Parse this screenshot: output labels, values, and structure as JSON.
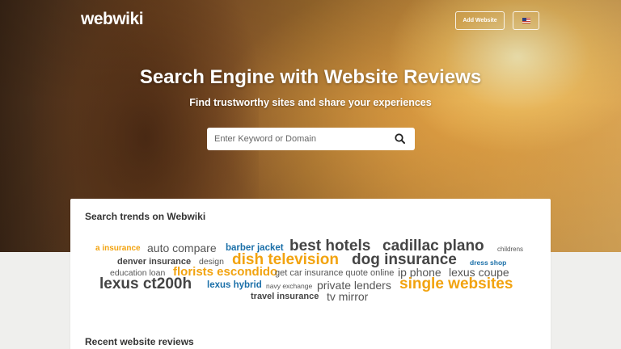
{
  "header": {
    "logo": "webwiki",
    "add_website_label": "Add Website",
    "language": "English (US)"
  },
  "hero": {
    "title": "Search Engine with Website Reviews",
    "subtitle": "Find trustworthy sites and share your experiences"
  },
  "search": {
    "placeholder": "Enter Keyword or Domain",
    "value": ""
  },
  "trends": {
    "title": "Search trends on Webwiki",
    "tags": {
      "a_insurance": "a insurance",
      "auto_compare": "auto compare",
      "barber_jacket": "barber jacket",
      "best_hotels": "best hotels",
      "cadillac_plano": "cadillac plano",
      "childrens": "childrens",
      "denver_insurance": "denver insurance",
      "design": "design",
      "dish_television": "dish television",
      "dog_insurance": "dog insurance",
      "dress_shop": "dress shop",
      "education_loan": "education loan",
      "florists_escondido": "florists escondido",
      "get_car_insurance": "get car insurance quote online",
      "ip_phone": "ip phone",
      "lexus_coupe": "lexus coupe",
      "lexus_ct200h": "lexus ct200h",
      "lexus_hybrid": "lexus hybrid",
      "navy_exchange": "navy exchange",
      "private_lenders": "private lenders",
      "single_websites": "single websites",
      "travel_insurance": "travel insurance",
      "tv_mirror": "tv mirror"
    }
  },
  "recent": {
    "title": "Recent website reviews"
  },
  "colors": {
    "accent_orange": "#f2a30f",
    "link_blue": "#1a6fa8",
    "text_dark": "#444444"
  },
  "icons": {
    "search": "magnifier-icon",
    "language": "us-flag-icon"
  }
}
